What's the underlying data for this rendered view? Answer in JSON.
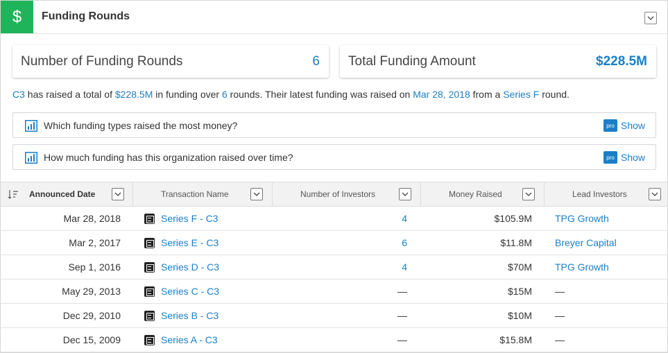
{
  "header": {
    "icon_glyph": "$",
    "title": "Funding Rounds",
    "collapse_icon": "chevron-down-icon"
  },
  "stats": {
    "rounds_label": "Number of Funding Rounds",
    "rounds_value": "6",
    "total_label": "Total Funding Amount",
    "total_value": "$228.5M"
  },
  "summary": {
    "org": "C3",
    "t1": " has raised a total of ",
    "amount": "$228.5M",
    "t2": " in funding over ",
    "rounds": "6",
    "t3": " rounds. Their latest funding was raised on ",
    "date": "Mar 28, 2018",
    "t4": " from a ",
    "series": "Series F",
    "t5": " round."
  },
  "questions": [
    {
      "text": "Which funding types raised the most money?",
      "badge": "pro",
      "action": "Show"
    },
    {
      "text": "How much funding has this organization raised over time?",
      "badge": "pro",
      "action": "Show"
    }
  ],
  "table": {
    "columns": [
      "Announced Date",
      "Transaction Name",
      "Number of Investors",
      "Money Raised",
      "Lead Investors"
    ],
    "rows": [
      {
        "date": "Mar 28, 2018",
        "txn": "Series F - C3",
        "investors": "4",
        "money": "$105.9M",
        "lead": "TPG Growth"
      },
      {
        "date": "Mar 2, 2017",
        "txn": "Series E - C3",
        "investors": "6",
        "money": "$11.8M",
        "lead": "Breyer Capital"
      },
      {
        "date": "Sep 1, 2016",
        "txn": "Series D - C3",
        "investors": "4",
        "money": "$70M",
        "lead": "TPG Growth"
      },
      {
        "date": "May 29, 2013",
        "txn": "Series C - C3",
        "investors": "—",
        "money": "$15M",
        "lead": "—"
      },
      {
        "date": "Dec 29, 2010",
        "txn": "Series B - C3",
        "investors": "—",
        "money": "$10M",
        "lead": "—"
      },
      {
        "date": "Dec 15, 2009",
        "txn": "Series A - C3",
        "investors": "—",
        "money": "$15.8M",
        "lead": "—"
      }
    ]
  },
  "colors": {
    "accent": "#1a7fc8",
    "header_icon_bg": "#1fb45a"
  }
}
